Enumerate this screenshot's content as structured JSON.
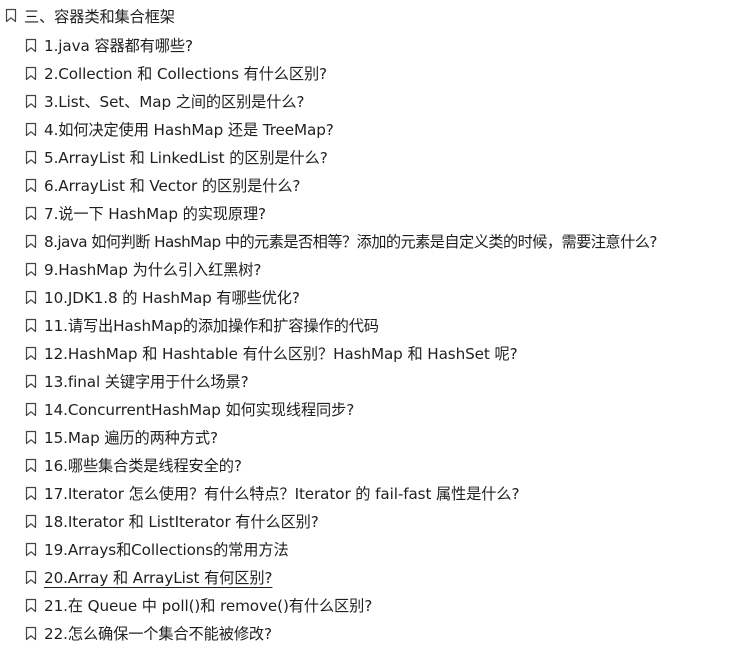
{
  "outline": {
    "root": {
      "label": "三、容器类和集合框架"
    },
    "items": [
      {
        "label": "1.java 容器都有哪些?"
      },
      {
        "label": "2.Collection 和 Collections 有什么区别?"
      },
      {
        "label": "3.List、Set、Map 之间的区别是什么?"
      },
      {
        "label": "4.如何决定使用 HashMap 还是 TreeMap?"
      },
      {
        "label": "5.ArrayList 和 LinkedList 的区别是什么?"
      },
      {
        "label": "6.ArrayList 和 Vector 的区别是什么?"
      },
      {
        "label": "7.说一下 HashMap 的实现原理?"
      },
      {
        "label": "8.java 如何判断 HashMap 中的元素是否相等？添加的元素是自定义类的时候，需要注意什么?"
      },
      {
        "label": "9.HashMap 为什么引入红黑树?"
      },
      {
        "label": "10.JDK1.8 的 HashMap 有哪些优化?"
      },
      {
        "label": "11.请写出HashMap的添加操作和扩容操作的代码"
      },
      {
        "label": "12.HashMap 和 Hashtable 有什么区别？HashMap 和 HashSet 呢?"
      },
      {
        "label": "13.final 关键字用于什么场景?"
      },
      {
        "label": "14.ConcurrentHashMap 如何实现线程同步?"
      },
      {
        "label": "15.Map 遍历的两种方式?"
      },
      {
        "label": "16.哪些集合类是线程安全的?"
      },
      {
        "label": "17.Iterator 怎么使用？有什么特点？Iterator 的 fail-fast 属性是什么?"
      },
      {
        "label": "18.Iterator 和 ListIterator 有什么区别?"
      },
      {
        "label": "19.Arrays和Collections的常用方法"
      },
      {
        "label": "20.Array 和 ArrayList 有何区别?"
      },
      {
        "label": "21.在 Queue 中 poll()和 remove()有什么区别?"
      },
      {
        "label": "22.怎么确保一个集合不能被修改?"
      }
    ],
    "hovered_index": 19
  },
  "icons": {
    "bookmark": "bookmark-icon"
  },
  "colors": {
    "text": "#1f1f1f",
    "icon": "#444444"
  }
}
